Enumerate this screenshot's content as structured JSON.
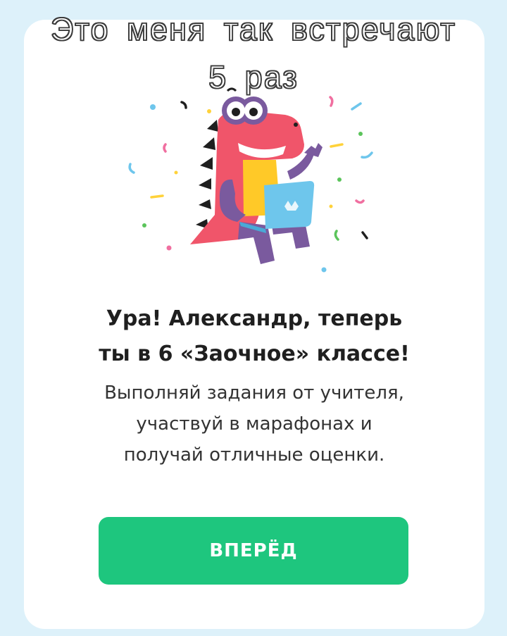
{
  "caption": {
    "line1": "Это меня так встречают",
    "line2": "5 раз"
  },
  "illustration": {
    "icon": "dinosaur-with-laptop-confetti-illustration"
  },
  "dialog": {
    "title_line1": "Ура! Александр, теперь",
    "title_line2": "ты в 6 «Заочное» классе!",
    "subtitle_line1": "Выполняй задания от учителя,",
    "subtitle_line2": "участвуй в марафонах и",
    "subtitle_line3": "получай отличные оценки.",
    "button_label": "ВПЕРЁД"
  },
  "colors": {
    "background": "#ddf1fa",
    "card": "#ffffff",
    "button": "#1ec67e",
    "dino_body": "#f0556a",
    "dino_purple": "#7a5a9e",
    "laptop": "#6ec6ec"
  }
}
